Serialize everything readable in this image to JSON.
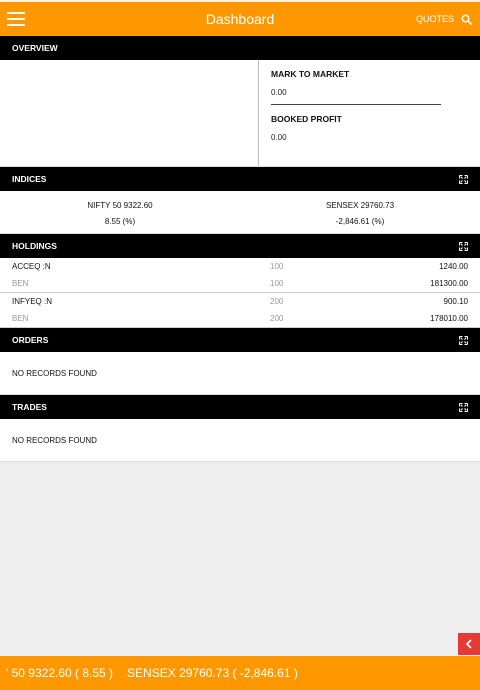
{
  "header": {
    "title": "Dashboard",
    "quotes_label": "QUOTES"
  },
  "overview": {
    "title": "OVERVIEW",
    "mark_to_market_label": "MARK TO MARKET",
    "mark_to_market_value": "0.00",
    "booked_profit_label": "BOOKED PROFIT",
    "booked_profit_value": "0.00"
  },
  "indices": {
    "title": "INDICES",
    "items": [
      {
        "name_value": "NIFTY 50 9322.60",
        "change": "8.55 (%)"
      },
      {
        "name_value": "SENSEX 29760.73",
        "change": "-2,846.61 (%)"
      }
    ]
  },
  "holdings": {
    "title": "HOLDINGS",
    "rows": [
      {
        "symbol": "ACCEQ :N",
        "qty": "100",
        "price": "1240.00",
        "sub_label": "BEN",
        "sub_qty": "100",
        "sub_value": "181300.00"
      },
      {
        "symbol": "INFYEQ :N",
        "qty": "200",
        "price": "900.10",
        "sub_label": "BEN",
        "sub_qty": "200",
        "sub_value": "178010.00"
      }
    ]
  },
  "orders": {
    "title": "ORDERS",
    "empty_text": "NO RECORDS FOUND"
  },
  "trades": {
    "title": "TRADES",
    "empty_text": "NO RECORDS FOUND"
  },
  "ticker": {
    "item1": "' 50 9322.60 ( 8.55 )",
    "item2": "SENSEX 29760.73 ( -2,846.61 )"
  },
  "colors": {
    "accent": "#ff9800",
    "section_header": "#000000",
    "back_button": "#e53935"
  },
  "icons": {
    "menu": "hamburger-menu-icon",
    "search": "search-icon",
    "expand": "expand-icon",
    "back": "chevron-left-icon"
  }
}
